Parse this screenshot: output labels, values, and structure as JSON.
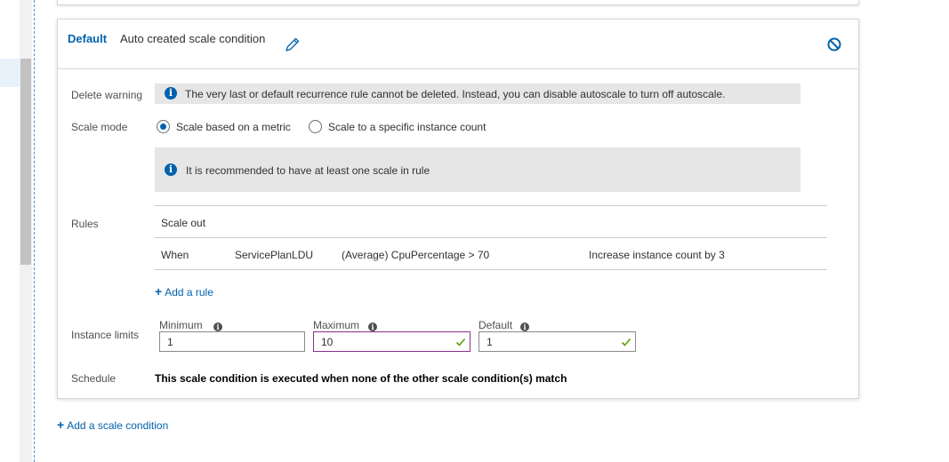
{
  "condition": {
    "default_label": "Default",
    "name": "Auto created scale condition"
  },
  "delete_warning": {
    "label": "Delete warning",
    "text": "The very last or default recurrence rule cannot be deleted. Instead, you can disable autoscale to turn off autoscale."
  },
  "scale_mode": {
    "label": "Scale mode",
    "options": [
      {
        "label": "Scale based on a metric",
        "selected": true
      },
      {
        "label": "Scale to a specific instance count",
        "selected": false
      }
    ],
    "recommendation": "It is recommended to have at least one scale in rule"
  },
  "rules": {
    "label": "Rules",
    "section_title": "Scale out",
    "rows": [
      {
        "when": "When",
        "resource": "ServicePlanLDU",
        "condition": "(Average) CpuPercentage > 70",
        "action": "Increase instance count by 3"
      }
    ],
    "add_rule_label": "Add a rule"
  },
  "instance_limits": {
    "label": "Instance limits",
    "minimum": {
      "label": "Minimum",
      "value": "1"
    },
    "maximum": {
      "label": "Maximum",
      "value": "10"
    },
    "default": {
      "label": "Default",
      "value": "1"
    }
  },
  "schedule": {
    "label": "Schedule",
    "text": "This scale condition is executed when none of the other scale condition(s) match"
  },
  "add_scale_condition_label": "Add a scale condition",
  "colors": {
    "accent": "#0062ad",
    "valid_check": "#5ba300",
    "focus_border": "#8b2d8a",
    "info_background": "#e6e6e6"
  }
}
